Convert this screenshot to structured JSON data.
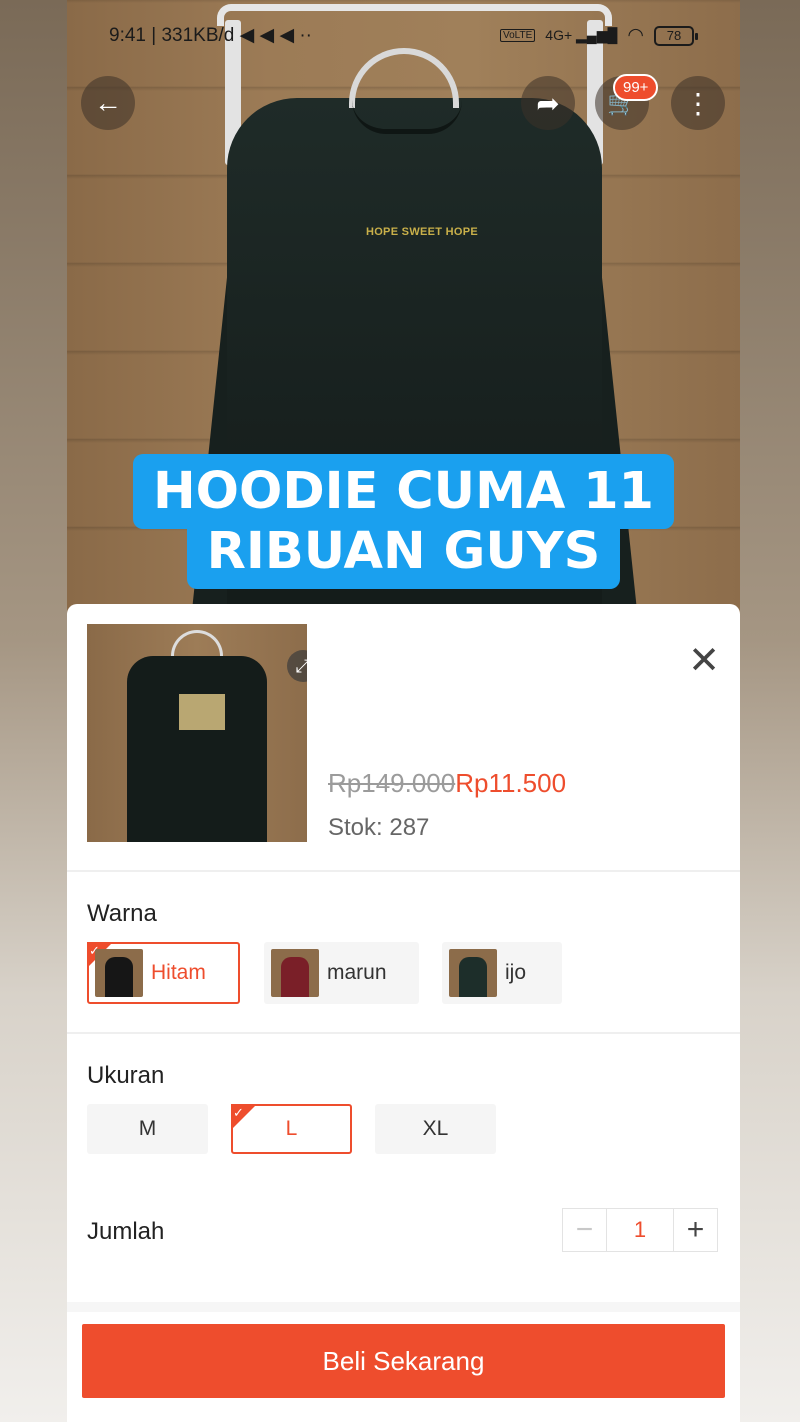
{
  "status_bar": {
    "time": "9:41",
    "net_speed": "| 331KB/d",
    "icons_left": "◀ ◀ ◀  ··",
    "lte_label": "VoLTE",
    "signal": "4G+ ▂▄▆█",
    "wifi": "◠",
    "battery": "78"
  },
  "nav": {
    "back_icon": "←",
    "share_icon": "➦",
    "cart_icon": "🛒",
    "more_icon": "⋮",
    "cart_badge": "99+"
  },
  "product_image": {
    "print_text": "HOPE SWEET HOPE"
  },
  "caption": {
    "line1": "HOODIE CUMA 11",
    "line2": "RIBUAN GUYS"
  },
  "sheet": {
    "expand_icon": "⤢",
    "close_icon": "✕",
    "price_original": "Rp149.000",
    "price_sale": "Rp11.500",
    "stock": "Stok: 287",
    "color_section": {
      "title": "Warna",
      "options": [
        {
          "label": "Hitam",
          "selected": true,
          "swatch": "#161616"
        },
        {
          "label": "marun",
          "selected": false,
          "swatch": "#7a1f28"
        },
        {
          "label": "ijo",
          "selected": false,
          "swatch": "#1d2e2a"
        }
      ]
    },
    "size_section": {
      "title": "Ukuran",
      "options": [
        {
          "label": "M",
          "selected": false
        },
        {
          "label": "L",
          "selected": true
        },
        {
          "label": "XL",
          "selected": false
        }
      ]
    },
    "quantity": {
      "label": "Jumlah",
      "minus": "−",
      "value": "1",
      "plus": "+"
    },
    "buy_button": "Beli Sekarang"
  },
  "colors": {
    "accent": "#ee4d2d",
    "caption_bg": "#1aa0ef"
  }
}
